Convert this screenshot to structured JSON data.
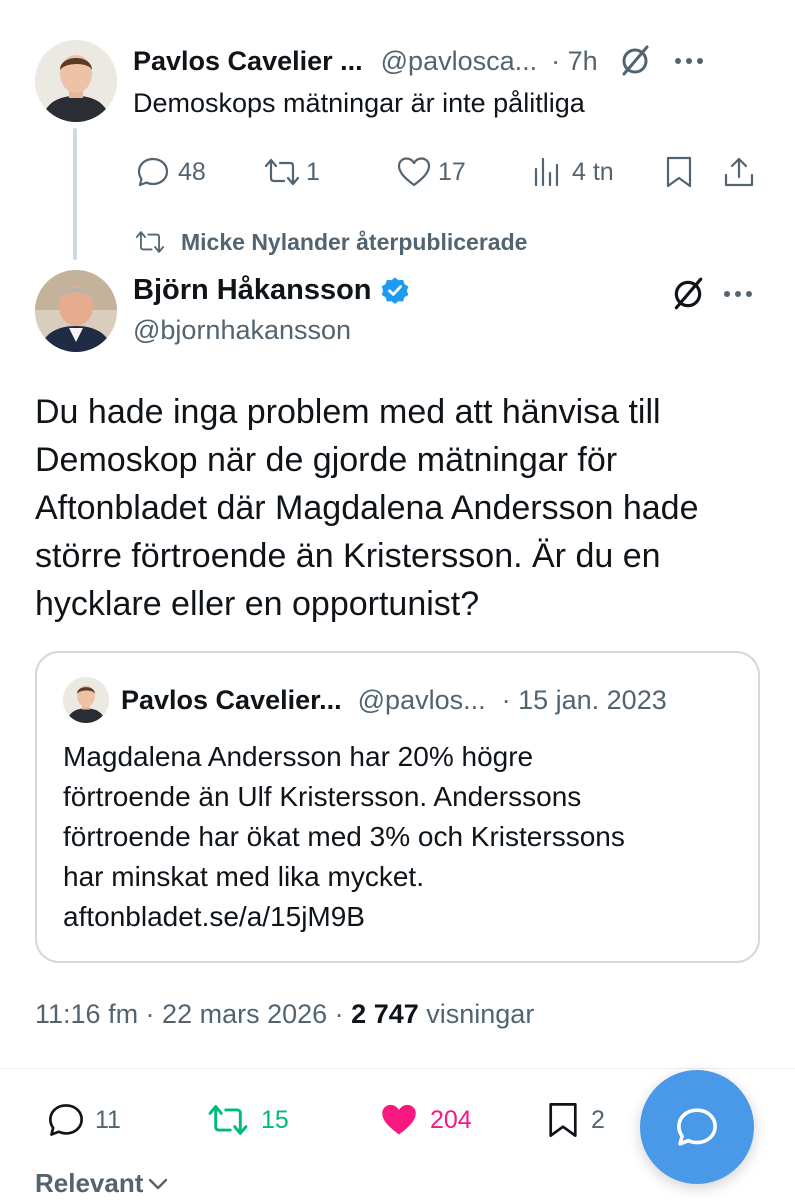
{
  "first_tweet": {
    "author_name": "Pavlos Cavelier ...",
    "handle": "@pavlosca...",
    "time": "· 7h",
    "text": "Demoskops mätningar är inte pålitliga",
    "replies": "48",
    "reposts": "1",
    "likes": "17",
    "views": "4 tn"
  },
  "repost_notice": "Micke Nylander återpublicerade",
  "main_tweet": {
    "author_name": "Björn Håkansson",
    "handle": "@bjornhakansson",
    "verified": true,
    "text_lines": [
      "Du hade inga problem med att hänvisa till",
      "Demoskop när de gjorde mätningar för",
      "Aftonbladet där Magdalena Andersson hade",
      "större förtroende än Kristersson. Är du en",
      "hycklare eller en opportunist?"
    ],
    "quoted": {
      "author_name": "Pavlos Cavelier...",
      "handle": "@pavlos...",
      "date": "· 15 jan. 2023",
      "text_lines": [
        "Magdalena Andersson har 20% högre",
        "förtroende än Ulf Kristersson. Anderssons",
        "förtroende har ökat med 3% och Kristerssons",
        "har minskat med lika mycket.",
        "aftonbladet.se/a/15jM9B"
      ]
    },
    "timestamp": "11:16 fm · 22 mars 2026 ·",
    "views_count": "2 747",
    "views_label": "visningar",
    "replies": "11",
    "reposts": "15",
    "likes": "204",
    "bookmarks": "2"
  },
  "sort_label": "Relevant",
  "colors": {
    "accent": "#1d9bf0",
    "fab": "#4a99e9",
    "like": "#f91880",
    "repost": "#00ba7c",
    "muted": "#536471"
  }
}
